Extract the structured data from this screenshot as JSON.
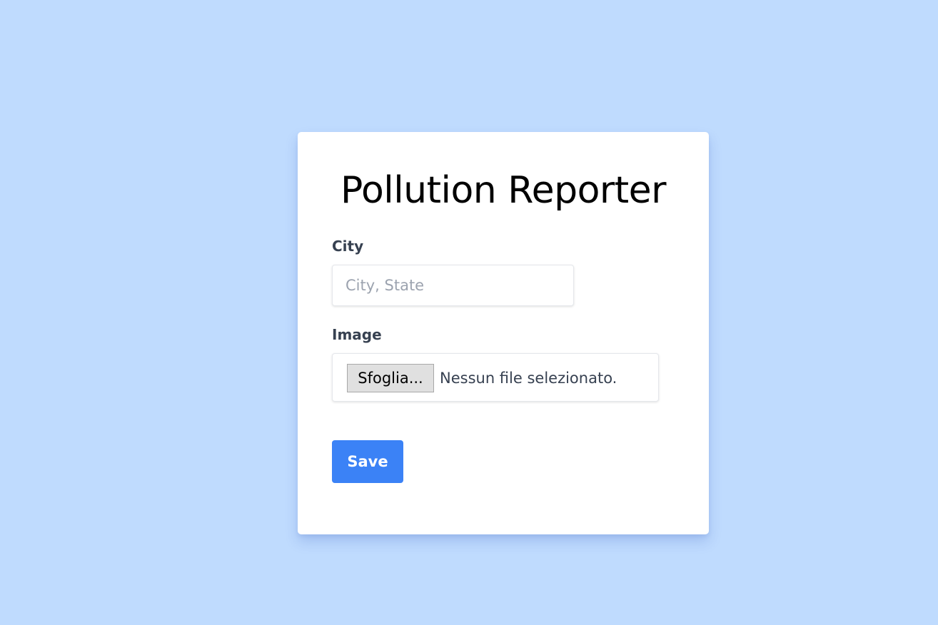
{
  "app": {
    "title": "Pollution Reporter"
  },
  "form": {
    "city": {
      "label": "City",
      "value": "",
      "placeholder": "City, State"
    },
    "image": {
      "label": "Image",
      "browse_label": "Sfoglia...",
      "status": "Nessun file selezionato."
    },
    "save_label": "Save"
  },
  "colors": {
    "background": "#bfdbfe",
    "card": "#ffffff",
    "accent": "#3b82f6",
    "label_text": "#374151",
    "placeholder_text": "#9ca3af"
  }
}
